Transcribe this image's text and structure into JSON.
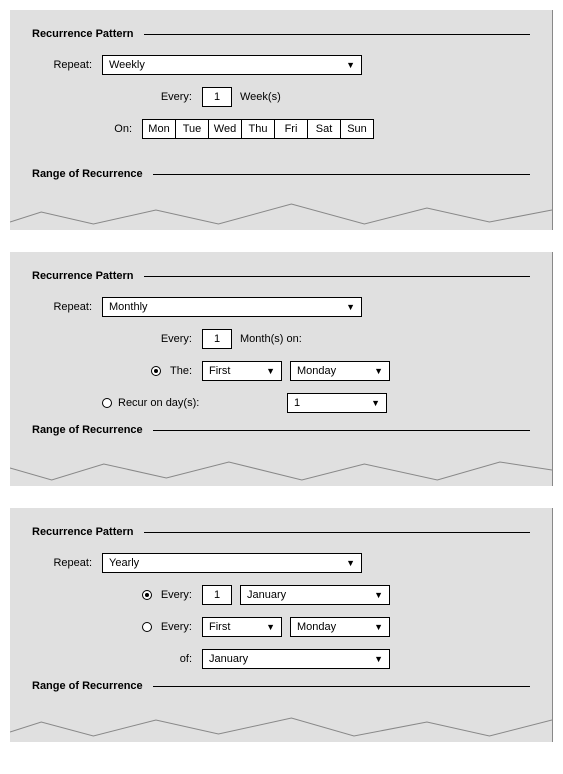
{
  "common": {
    "pattern_title": "Recurrence Pattern",
    "range_title": "Range of Recurrence",
    "repeat_label": "Repeat:",
    "every_label": "Every:",
    "on_label": "On:"
  },
  "weekly": {
    "repeat_value": "Weekly",
    "every_value": "1",
    "every_unit": "Week(s)",
    "days": [
      "Mon",
      "Tue",
      "Wed",
      "Thu",
      "Fri",
      "Sat",
      "Sun"
    ]
  },
  "monthly": {
    "repeat_value": "Monthly",
    "every_value": "1",
    "every_unit": "Month(s) on:",
    "the_label": "The:",
    "the_ordinal": "First",
    "the_day": "Monday",
    "recur_label": "Recur on day(s):",
    "recur_value": "1"
  },
  "yearly": {
    "repeat_value": "Yearly",
    "opt1_label": "Every:",
    "opt1_value": "1",
    "opt1_month": "January",
    "opt2_label": "Every:",
    "opt2_ordinal": "First",
    "opt2_day": "Monday",
    "of_label": "of:",
    "of_month": "January"
  }
}
